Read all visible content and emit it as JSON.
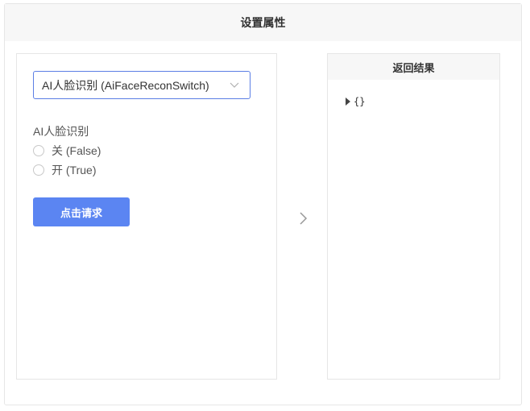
{
  "page": {
    "title": "设置属性"
  },
  "form": {
    "select": {
      "value": "AI人脸识别 (AiFaceReconSwitch)"
    },
    "group_label": "AI人脸识别",
    "options": [
      {
        "label": "关 (False)"
      },
      {
        "label": "开 (True)"
      }
    ],
    "submit_label": "点击请求"
  },
  "result": {
    "title": "返回结果",
    "json_text": "{}"
  },
  "colors": {
    "accent": "#5b85f2",
    "select_border": "#5b7ee5",
    "header_bg": "#f7f7f7",
    "border": "#e6e6e6"
  },
  "icons": {
    "select_chevron": "chevron-down-icon",
    "arrow": "chevron-right-icon",
    "json_toggle": "caret-right-icon"
  }
}
